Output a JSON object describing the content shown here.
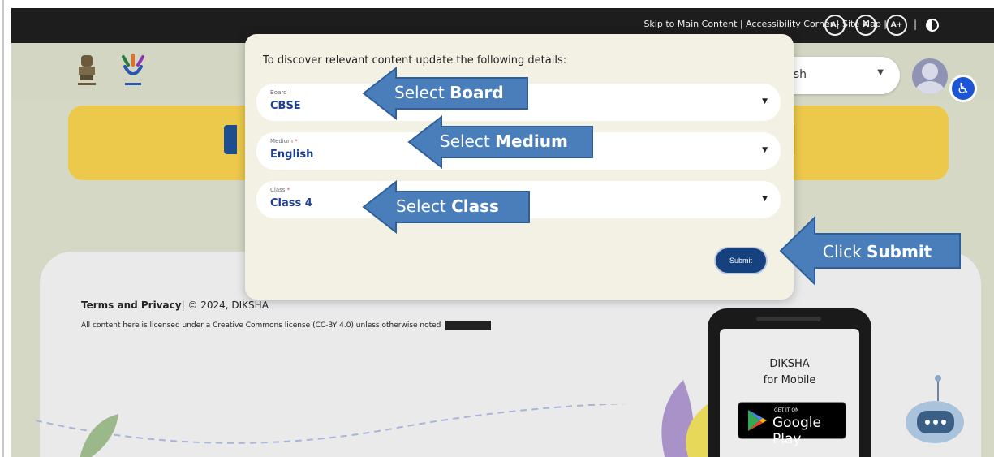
{
  "topbar": {
    "links": "Skip to Main Content | Accessibility Corner | Site Map |",
    "font_decrease": "A-",
    "font_normal": "A",
    "font_increase": "A+",
    "separator": "|"
  },
  "header": {
    "language_value": "ish",
    "icons": [
      "national-emblem-icon",
      "diksha-logo-icon",
      "user-avatar-icon",
      "accessibility-icon"
    ]
  },
  "modal": {
    "title": "To discover relevant content update the following details:",
    "board": {
      "label": "Board",
      "value": "CBSE"
    },
    "medium": {
      "label": "Medium",
      "required": "*",
      "value": "English"
    },
    "class": {
      "label": "Class",
      "required": "*",
      "value": "Class 4"
    },
    "submit_label": "Submit"
  },
  "callouts": {
    "board": {
      "prefix": "Select ",
      "bold": "Board"
    },
    "medium": {
      "prefix": "Select ",
      "bold": "Medium"
    },
    "class": {
      "prefix": "Select ",
      "bold": "Class"
    },
    "submit": {
      "prefix": "Click ",
      "bold": "Submit"
    }
  },
  "footer": {
    "terms_link": "Terms and Privacy",
    "copyright": "| © 2024, DIKSHA",
    "license": "All content here is licensed under a Creative Commons license (CC-BY 4.0) unless otherwise noted",
    "mobile_title_1": "DIKSHA",
    "mobile_title_2": "for Mobile",
    "gplay_small": "GET IT ON",
    "gplay_big": "Google Play"
  },
  "colors": {
    "callout_blue": "#4a7ebb",
    "banner_yellow": "#ecc94b",
    "submit_blue": "#15427f",
    "value_blue": "#1d3f8f"
  }
}
